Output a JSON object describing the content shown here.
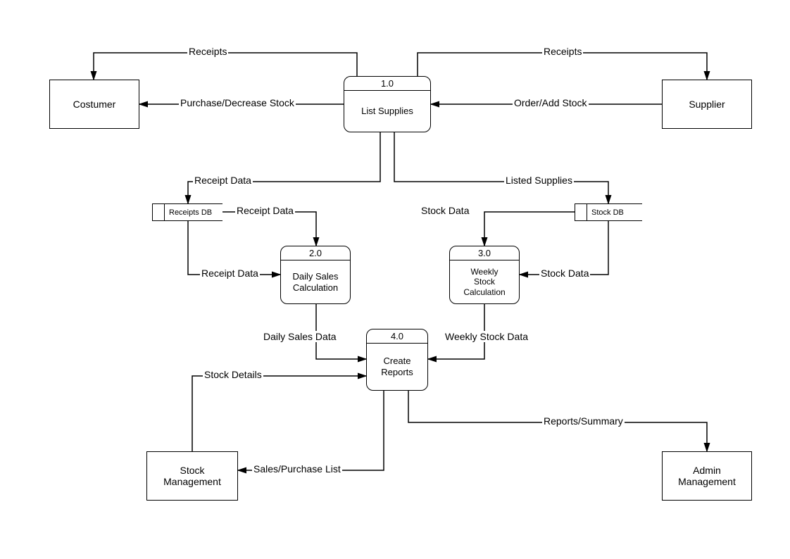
{
  "entities": {
    "customer": "Costumer",
    "supplier": "Supplier",
    "stock_mgmt": "Stock\nManagement",
    "admin_mgmt": "Admin\nManagement"
  },
  "processes": {
    "p1": {
      "id": "1.0",
      "name": "List Supplies"
    },
    "p2": {
      "id": "2.0",
      "name": "Daily Sales\nCalculation"
    },
    "p3": {
      "id": "3.0",
      "name": "Weekly\nStock\nCalculation"
    },
    "p4": {
      "id": "4.0",
      "name": "Create\nReports"
    }
  },
  "datastores": {
    "receipts_db": "Receipts DB",
    "stock_db": "Stock DB"
  },
  "flows": {
    "f_receipts_to_customer": "Receipts",
    "f_receipts_to_supplier": "Receipts",
    "f_order_add_stock": "Order/Add Stock",
    "f_purchase_decrease": "Purchase/Decrease Stock",
    "f_receipt_data_down": "Receipt Data",
    "f_listed_supplies": "Listed Supplies",
    "f_receipt_data_right": "Receipt Data",
    "f_stock_data_left": "Stock Data",
    "f_receipt_data_to_p2": "Receipt Data",
    "f_stock_data_to_p3": "Stock Data",
    "f_daily_sales_data": "Daily Sales Data",
    "f_weekly_stock_data": "Weekly Stock Data",
    "f_stock_details": "Stock Details",
    "f_sales_purchase_list": "Sales/Purchase List",
    "f_reports_summary": "Reports/Summary"
  }
}
